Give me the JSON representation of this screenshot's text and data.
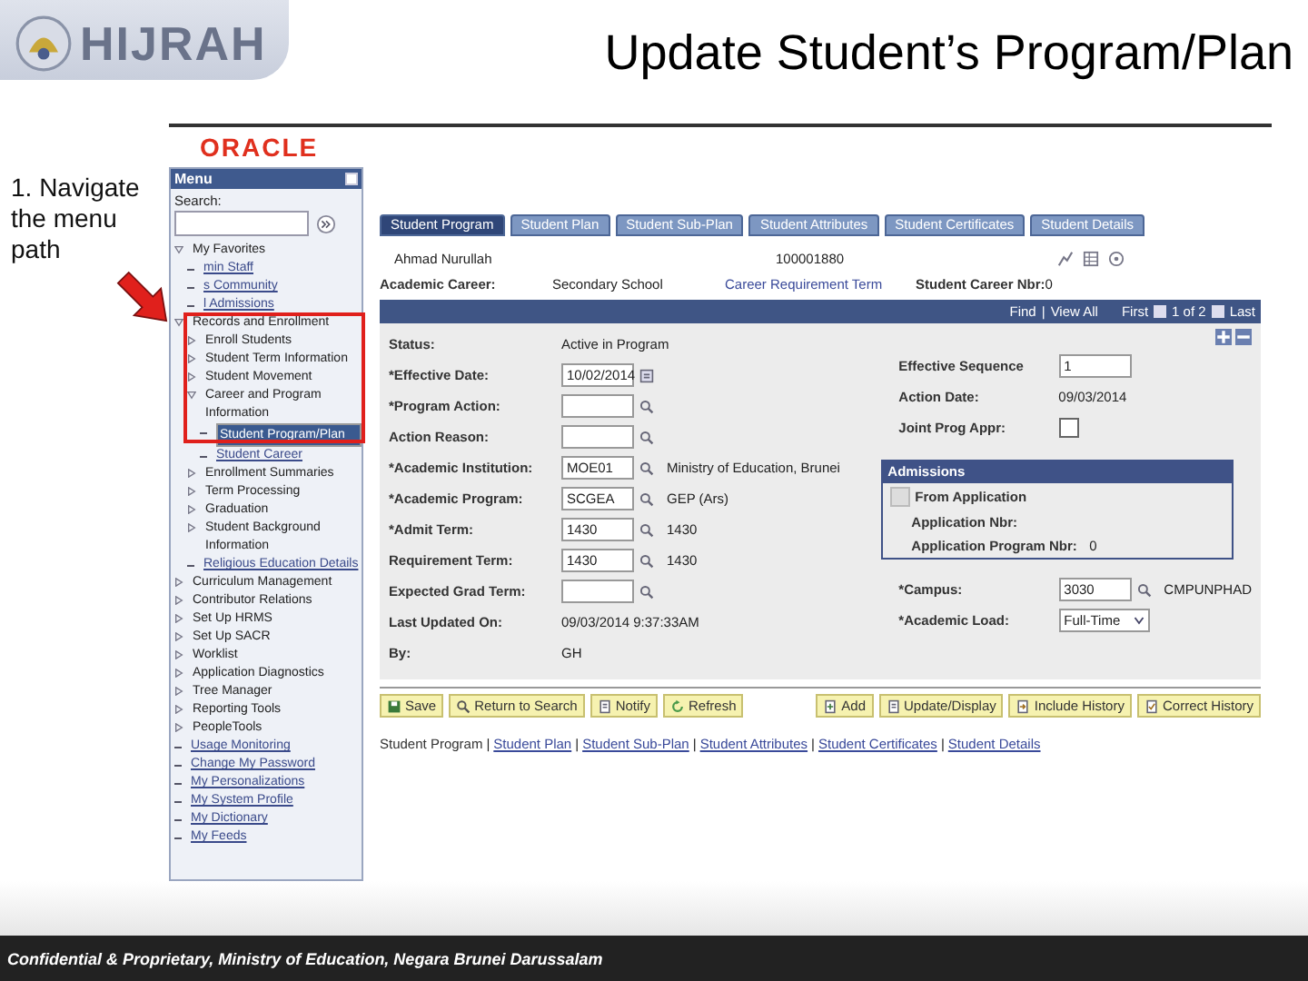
{
  "slide": {
    "logo_text": "HIJRAH",
    "title": "Update Student’s Program/Plan",
    "instruction": "1. Navigate the menu path",
    "footer": "Confidential & Proprietary, Ministry of Education, Negara Brunei Darussalam"
  },
  "brand": "ORACLE",
  "menu": {
    "title": "Menu",
    "search_label": "Search:",
    "items": [
      {
        "label": "My Favorites",
        "kind": "folder",
        "expanded": true,
        "children": [
          {
            "label": "min Staff",
            "kind": "link",
            "selected": false
          },
          {
            "label": "s Community",
            "kind": "link",
            "selected": false
          },
          {
            "label": "l Admissions",
            "kind": "link",
            "selected": false
          }
        ]
      },
      {
        "label": "Records and Enrollment",
        "kind": "folder",
        "expanded": true,
        "children": [
          {
            "label": "Enroll Students",
            "kind": "folder",
            "expanded": false
          },
          {
            "label": "Student Term Information",
            "kind": "folder",
            "expanded": false
          },
          {
            "label": "Student Movement",
            "kind": "folder",
            "expanded": false
          },
          {
            "label": "Career and Program Information",
            "kind": "folder",
            "expanded": true,
            "children": [
              {
                "label": "Student Program/Plan",
                "kind": "link",
                "selected": true
              },
              {
                "label": "Student Career",
                "kind": "link",
                "selected": false
              }
            ]
          },
          {
            "label": "Enrollment Summaries",
            "kind": "folder",
            "expanded": false
          },
          {
            "label": "Term Processing",
            "kind": "folder",
            "expanded": false
          },
          {
            "label": "Graduation",
            "kind": "folder",
            "expanded": false
          },
          {
            "label": "Student Background Information",
            "kind": "folder",
            "expanded": false
          },
          {
            "label": "Religious Education Details",
            "kind": "link",
            "selected": false
          }
        ]
      },
      {
        "label": "Curriculum Management",
        "kind": "folder",
        "expanded": false
      },
      {
        "label": "Contributor Relations",
        "kind": "folder",
        "expanded": false
      },
      {
        "label": "Set Up HRMS",
        "kind": "folder",
        "expanded": false
      },
      {
        "label": "Set Up SACR",
        "kind": "folder",
        "expanded": false
      },
      {
        "label": "Worklist",
        "kind": "folder",
        "expanded": false
      },
      {
        "label": "Application Diagnostics",
        "kind": "folder",
        "expanded": false
      },
      {
        "label": "Tree Manager",
        "kind": "folder",
        "expanded": false
      },
      {
        "label": "Reporting Tools",
        "kind": "folder",
        "expanded": false
      },
      {
        "label": "PeopleTools",
        "kind": "folder",
        "expanded": false
      },
      {
        "label": "Usage Monitoring",
        "kind": "link",
        "selected": false
      },
      {
        "label": "Change My Password",
        "kind": "link",
        "selected": false
      },
      {
        "label": "My Personalizations",
        "kind": "link",
        "selected": false
      },
      {
        "label": "My System Profile",
        "kind": "link",
        "selected": false
      },
      {
        "label": "My Dictionary",
        "kind": "link",
        "selected": false
      },
      {
        "label": "My Feeds",
        "kind": "link",
        "selected": false
      }
    ]
  },
  "tabs": [
    {
      "label": "Student Program",
      "selected": true
    },
    {
      "label": "Student Plan",
      "selected": false
    },
    {
      "label": "Student Sub-Plan",
      "selected": false
    },
    {
      "label": "Student Attributes",
      "selected": false
    },
    {
      "label": "Student Certificates",
      "selected": false
    },
    {
      "label": "Student Details",
      "selected": false
    }
  ],
  "header": {
    "name": "Ahmad Nurullah",
    "id": "100001880",
    "career_label": "Academic Career:",
    "career": "Secondary School",
    "requirement_term_link": "Career Requirement Term",
    "career_nbr_label": "Student Career Nbr:",
    "career_nbr": "0"
  },
  "nav": {
    "find": "Find",
    "separator": "|",
    "view_all": "View All",
    "first": "First",
    "position": "1 of 2",
    "last": "Last"
  },
  "form_left": [
    {
      "label": "Status:",
      "kind": "text",
      "value": "Active in Program"
    },
    {
      "label": "*Effective Date:",
      "kind": "date",
      "value": "10/02/2014"
    },
    {
      "label": "*Program Action:",
      "kind": "input",
      "lookup": true
    },
    {
      "label": "Action Reason:",
      "kind": "input",
      "lookup": true
    },
    {
      "label": "*Academic Institution:",
      "kind": "input",
      "value": "MOE01",
      "lookup": true,
      "description": "Ministry of Education, Brunei"
    },
    {
      "label": "*Academic Program:",
      "kind": "input",
      "value": "SCGEA",
      "lookup": true,
      "description": "GEP (Ars)"
    },
    {
      "label": "*Admit Term:",
      "kind": "input",
      "value": "1430",
      "lookup": true,
      "description": "1430"
    },
    {
      "label": "Requirement Term:",
      "kind": "input",
      "value": "1430",
      "lookup": true,
      "description": "1430"
    },
    {
      "label": "Expected Grad Term:",
      "kind": "input",
      "lookup": true
    },
    {
      "label": "Last Updated On:",
      "kind": "text",
      "value": "09/03/2014  9:37:33AM"
    },
    {
      "label": "By:",
      "kind": "text",
      "value": "GH"
    }
  ],
  "form_right": [
    {
      "label": "Effective Sequence",
      "kind": "input",
      "value": "1"
    },
    {
      "label": "Action Date:",
      "kind": "text",
      "value": "09/03/2014"
    },
    {
      "label": "Joint Prog Appr:",
      "kind": "checkbox",
      "checked": false
    }
  ],
  "admissions": {
    "title": "Admissions",
    "from_application": {
      "label": "From Application",
      "checked": false,
      "disabled": true
    },
    "rows": [
      {
        "label": "Application Nbr:"
      },
      {
        "label": "Application Program Nbr:",
        "value": "0"
      }
    ]
  },
  "form_right_lower": [
    {
      "label": "*Campus:",
      "kind": "input",
      "value": "3030",
      "lookup": true,
      "description": "CMPUNPHAD"
    },
    {
      "label": "*Academic Load:",
      "kind": "select",
      "value": "Full-Time"
    }
  ],
  "buttons_left": [
    {
      "label": "Save",
      "kind": "save"
    },
    {
      "label": "Return to Search",
      "kind": "search"
    },
    {
      "label": "Notify",
      "kind": "notify"
    },
    {
      "label": "Refresh",
      "kind": "refresh"
    }
  ],
  "buttons_right": [
    {
      "label": "Add",
      "kind": "add"
    },
    {
      "label": "Update/Display",
      "kind": "update"
    },
    {
      "label": "Include History",
      "kind": "include"
    },
    {
      "label": "Correct History",
      "kind": "correct"
    }
  ],
  "page_links": [
    {
      "kind": "link",
      "label": "Student Program",
      "selected": true
    },
    {
      "kind": "separator",
      "text": "|"
    },
    {
      "kind": "link",
      "label": "Student Plan",
      "selected": false
    },
    {
      "kind": "separator",
      "text": "|"
    },
    {
      "kind": "link",
      "label": "Student Sub-Plan",
      "selected": false
    },
    {
      "kind": "separator",
      "text": "|"
    },
    {
      "kind": "link",
      "label": "Student Attributes",
      "selected": false
    },
    {
      "kind": "separator",
      "text": "|"
    },
    {
      "kind": "link",
      "label": "Student Certificates",
      "selected": false
    },
    {
      "kind": "separator",
      "text": "|"
    },
    {
      "kind": "link",
      "label": "Student Details",
      "selected": false
    }
  ]
}
